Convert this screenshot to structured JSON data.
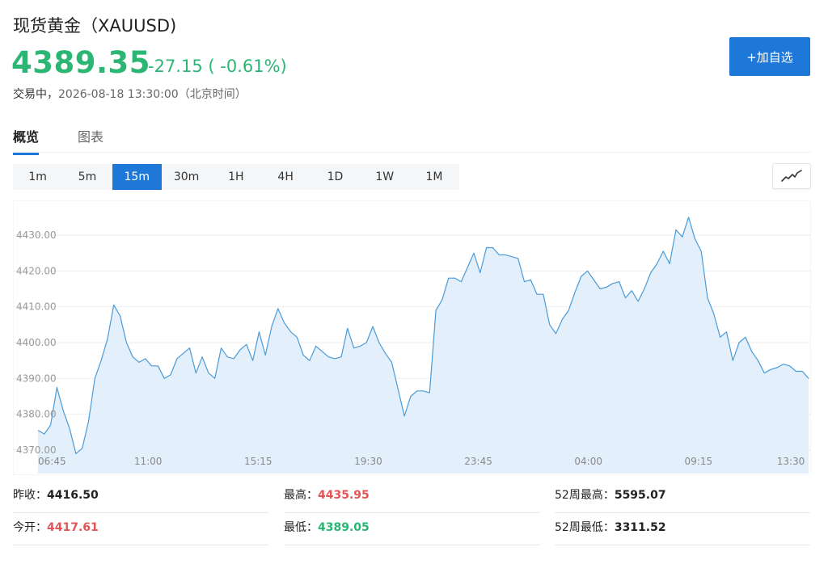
{
  "header": {
    "title": "现货黄金（XAUUSD)",
    "price": "4389.35",
    "change": "-27.15 ( -0.61%)",
    "status_label": "交易中，",
    "timestamp": "2026-08-18 13:30:00（北京时间）",
    "add_button": "+加自选"
  },
  "tabs": [
    {
      "label": "概览",
      "active": true
    },
    {
      "label": "图表",
      "active": false
    }
  ],
  "periods": [
    {
      "label": "1m",
      "active": false
    },
    {
      "label": "5m",
      "active": false
    },
    {
      "label": "15m",
      "active": true
    },
    {
      "label": "30m",
      "active": false
    },
    {
      "label": "1H",
      "active": false
    },
    {
      "label": "4H",
      "active": false
    },
    {
      "label": "1D",
      "active": false
    },
    {
      "label": "1W",
      "active": false
    },
    {
      "label": "1M",
      "active": false
    }
  ],
  "chart_type_icon": "line-chart-icon",
  "colors": {
    "accent": "#1e78d7",
    "down": "#2bb673",
    "up": "#e55454",
    "line": "#4a9bd8",
    "fill": "#e3f0fb"
  },
  "chart_data": {
    "type": "area",
    "ylim": [
      4368,
      4440
    ],
    "y_ticks": [
      "4370.00",
      "4380.00",
      "4390.00",
      "4400.00",
      "4410.00",
      "4420.00",
      "4430.00"
    ],
    "x_ticks": [
      "06:45",
      "11:00",
      "15:15",
      "19:30",
      "23:45",
      "04:00",
      "09:15",
      "13:30"
    ],
    "values": [
      4375.5,
      4374.5,
      4377,
      4387.5,
      4381,
      4376,
      4369,
      4370.5,
      4378,
      4390,
      4395,
      4401,
      4410.5,
      4407.5,
      4400,
      4396,
      4394.5,
      4395.5,
      4393.5,
      4393.5,
      4390,
      4391,
      4395.5,
      4397,
      4398.5,
      4391.5,
      4396,
      4391.5,
      4390,
      4398.5,
      4396,
      4395.5,
      4398,
      4399.5,
      4395,
      4403,
      4396.5,
      4404.5,
      4409.5,
      4405.5,
      4403,
      4401.5,
      4396.5,
      4395,
      4399,
      4397.5,
      4396,
      4395.5,
      4396,
      4404,
      4398.5,
      4399,
      4400,
      4404.5,
      4400,
      4397,
      4394.5,
      4387,
      4379.5,
      4385,
      4386.5,
      4386.5,
      4386,
      4409,
      4412,
      4418,
      4418,
      4417,
      4421,
      4425,
      4419.5,
      4426.5,
      4426.5,
      4424.5,
      4424.5,
      4424,
      4423.5,
      4417,
      4417.5,
      4413.5,
      4413.5,
      4405,
      4402.5,
      4406.5,
      4409,
      4414,
      4418.5,
      4420,
      4417.5,
      4415,
      4415.5,
      4416.5,
      4417,
      4412.5,
      4414.5,
      4411.5,
      4415,
      4419.5,
      4422,
      4425.5,
      4422,
      4431.5,
      4429.5,
      4435,
      4429,
      4425.5,
      4412.5,
      4408,
      4401.5,
      4403,
      4395,
      4400,
      4401.5,
      4397.5,
      4395,
      4391.5,
      4392.5,
      4393,
      4394,
      4393.5,
      4392,
      4392,
      4390
    ]
  },
  "stats": {
    "prev_close": {
      "label": "昨收：",
      "value": "4416.50"
    },
    "open": {
      "label": "今开：",
      "value": "4417.61"
    },
    "high": {
      "label": "最高：",
      "value": "4435.95"
    },
    "low": {
      "label": "最低：",
      "value": "4389.05"
    },
    "week52_high": {
      "label": "52周最高：",
      "value": "5595.07"
    },
    "week52_low": {
      "label": "52周最低：",
      "value": "3311.52"
    }
  }
}
